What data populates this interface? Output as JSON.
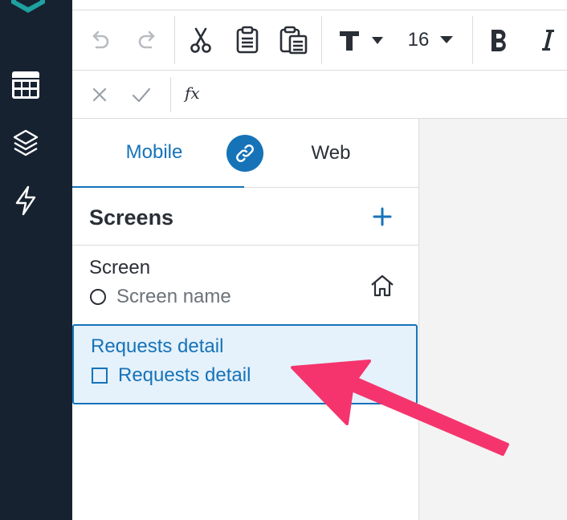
{
  "toolbar": {
    "font_size": "16",
    "icons": [
      "undo-icon",
      "redo-icon",
      "cut-icon",
      "copy-icon",
      "paste-icon",
      "text-format-icon",
      "bold-icon",
      "italic-icon"
    ]
  },
  "formula_bar": {
    "fx_label": "fx"
  },
  "tabs": {
    "mobile": "Mobile",
    "web": "Web"
  },
  "screens": {
    "title": "Screens",
    "items": [
      {
        "name": "Screen",
        "sub": "Screen name",
        "selected": false
      },
      {
        "name": "Requests detail",
        "sub": "Requests detail",
        "selected": true
      }
    ]
  },
  "colors": {
    "accent": "#1673b8",
    "rail": "#172231",
    "selection_bg": "#e5f1fb",
    "arrow": "#f5346d"
  }
}
